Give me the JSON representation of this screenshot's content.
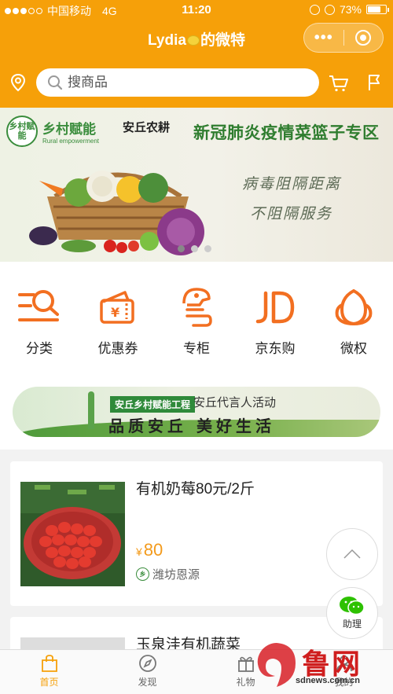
{
  "status_bar": {
    "carrier": "中国移动",
    "network": "4G",
    "time": "11:20",
    "battery": "73%",
    "battery_level": 0.73
  },
  "header": {
    "title_prefix": "Lydia",
    "title_suffix": "的微特",
    "title_emoji_icon": "lemon-icon",
    "more_icon": "more-dots-icon",
    "close_icon": "target-icon"
  },
  "search": {
    "placeholder": "搜商品",
    "location_icon": "location-pin-icon",
    "cart_icon": "cart-icon",
    "flag_icon": "flag-icon"
  },
  "banner": {
    "logo_rural": "乡村赋能",
    "logo_rural_badge": "乡村赋能",
    "logo_rural_en": "Rural empowerment",
    "logo_anqiu": "安丘农耕",
    "headline": "新冠肺炎疫情菜篮子专区",
    "slogan_1": "病毒阻隔距离",
    "slogan_2": "不阻隔服务",
    "slides_total": 3,
    "active_slide": 1
  },
  "categories": [
    {
      "label": "分类",
      "icon": "category-search-icon"
    },
    {
      "label": "优惠券",
      "icon": "coupon-icon"
    },
    {
      "label": "专柜",
      "icon": "counter-icon"
    },
    {
      "label": "京东购",
      "icon": "jd-icon"
    },
    {
      "label": "微权",
      "icon": "weiquan-icon"
    }
  ],
  "promo": {
    "tag": "安丘乡村赋能工程",
    "subtitle": "安丘代言人活动",
    "main": "品质安丘 美好生活"
  },
  "products": [
    {
      "name": "有机奶莓80元/2斤",
      "price": "80",
      "currency": "¥",
      "shop": "潍坊恩源",
      "shop_badge": "乡"
    },
    {
      "name": "玉泉洼有机蔬菜"
    }
  ],
  "floating": {
    "help_label": "助理"
  },
  "tabbar": [
    {
      "label": "首页",
      "icon": "home-bag-icon",
      "active": true
    },
    {
      "label": "发现",
      "icon": "compass-icon",
      "active": false
    },
    {
      "label": "礼物",
      "icon": "gift-icon",
      "active": false
    },
    {
      "label": "我的",
      "icon": "user-icon",
      "active": false
    }
  ],
  "watermark": {
    "text": "鲁网",
    "url": "sdnews.com.cn"
  },
  "colors": {
    "brand": "#f6a009",
    "icon_orange": "#f26f21",
    "price": "#f39a1b",
    "green": "#3a8d3c"
  }
}
